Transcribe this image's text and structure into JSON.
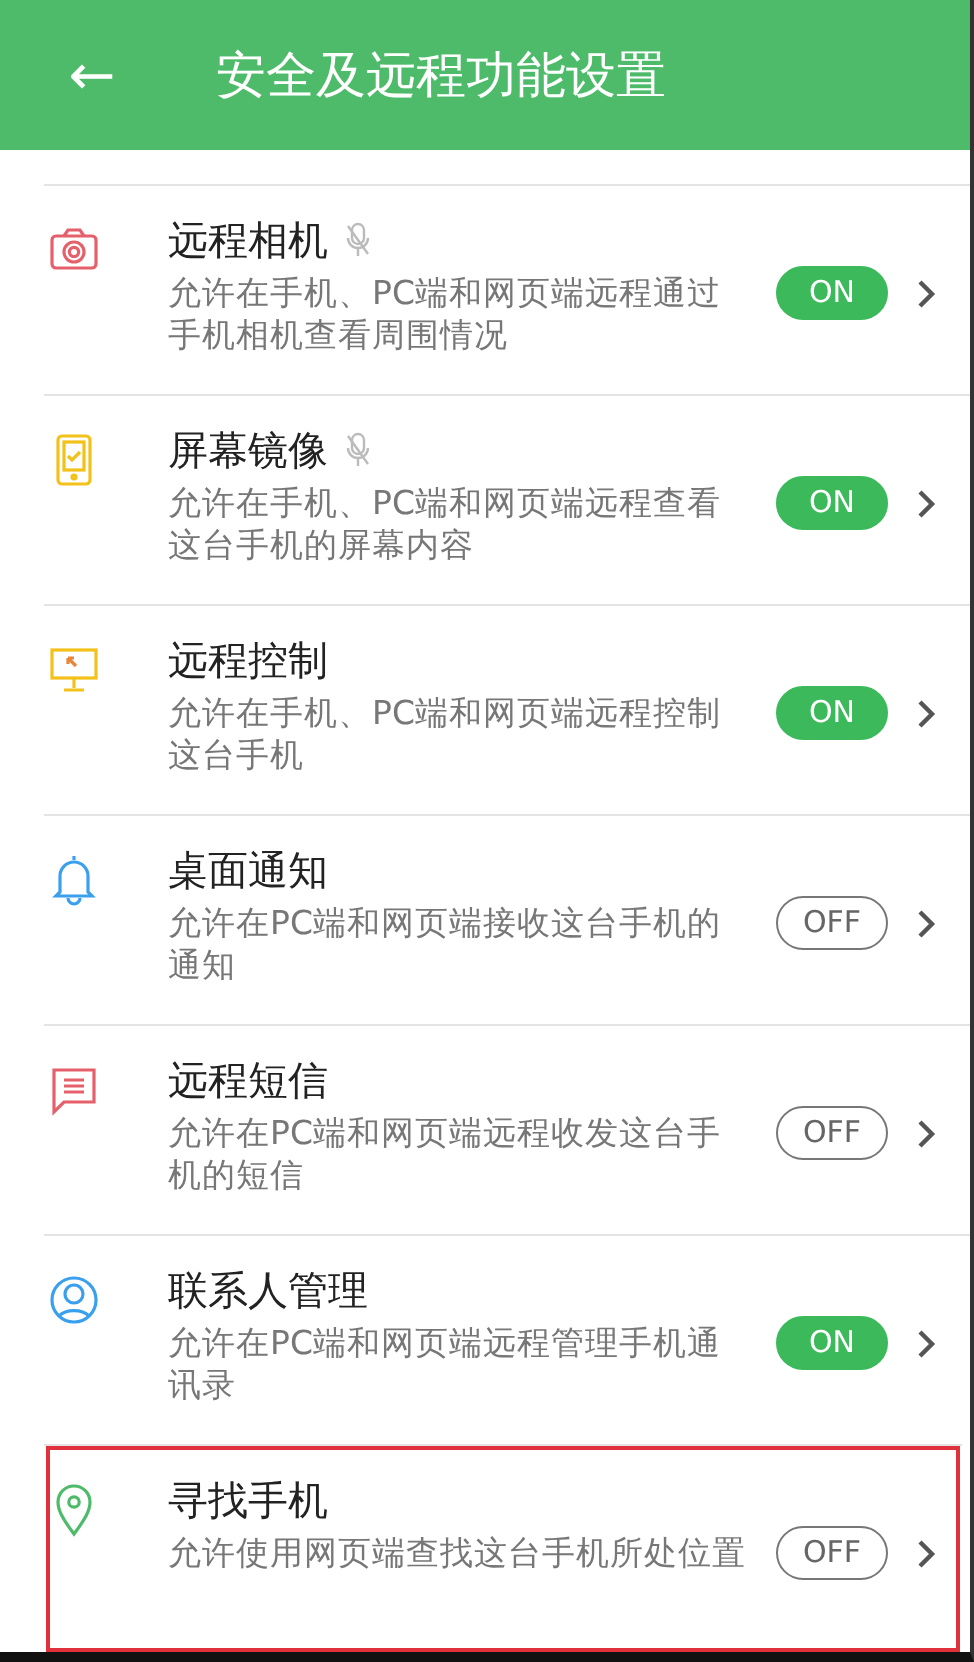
{
  "header": {
    "back": "←",
    "title": "安全及远程功能设置"
  },
  "settings": [
    {
      "kind": "camera",
      "title": "远程相机",
      "mic": true,
      "description": "允许在手机、PC端和网页端远程通过手机相机查看周围情况",
      "on": true,
      "toggle": "ON",
      "highlighted": false
    },
    {
      "kind": "tablet",
      "title": "屏幕镜像",
      "mic": true,
      "description": "允许在手机、PC端和网页端远程查看这台手机的屏幕内容",
      "on": true,
      "toggle": "ON",
      "highlighted": false
    },
    {
      "kind": "monitor",
      "title": "远程控制",
      "mic": false,
      "description": "允许在手机、PC端和网页端远程控制这台手机",
      "on": true,
      "toggle": "ON",
      "highlighted": false
    },
    {
      "kind": "bell",
      "title": "桌面通知",
      "mic": false,
      "description": "允许在PC端和网页端接收这台手机的通知",
      "on": false,
      "toggle": "OFF",
      "highlighted": false
    },
    {
      "kind": "message",
      "title": "远程短信",
      "mic": false,
      "description": "允许在PC端和网页端远程收发这台手机的短信",
      "on": false,
      "toggle": "OFF",
      "highlighted": false
    },
    {
      "kind": "person",
      "title": "联系人管理",
      "mic": false,
      "description": "允许在PC端和网页端远程管理手机通讯录",
      "on": true,
      "toggle": "ON",
      "highlighted": false
    },
    {
      "kind": "pin",
      "title": "寻找手机",
      "mic": false,
      "description": "允许使用网页端查找这台手机所处位置",
      "on": false,
      "toggle": "OFF",
      "highlighted": true
    }
  ]
}
